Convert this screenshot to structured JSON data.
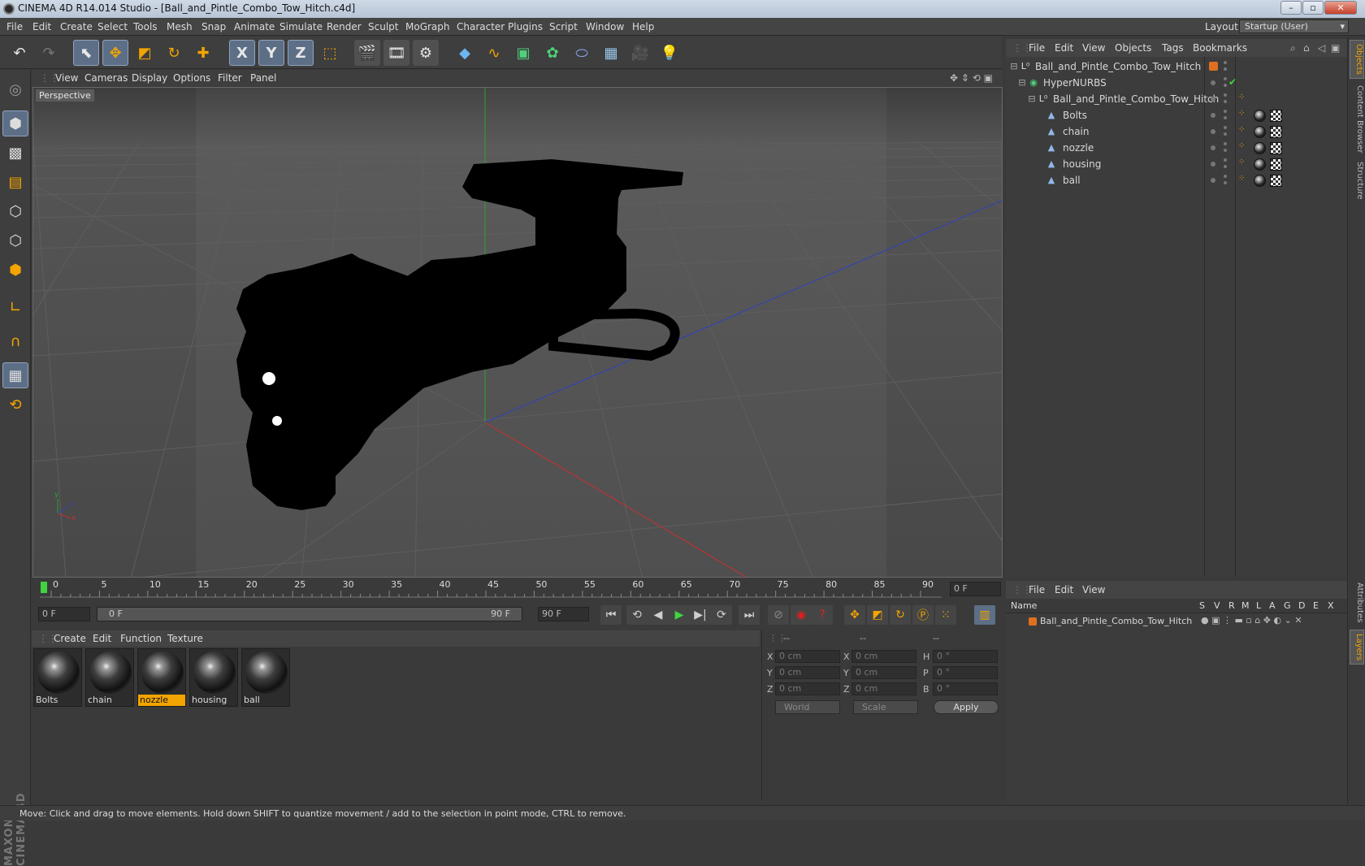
{
  "app": {
    "title": "CINEMA 4D R14.014 Studio - [Ball_and_Pintle_Combo_Tow_Hitch.c4d]",
    "window_buttons": {
      "minimize": "–",
      "maximize": "▫",
      "close": "✕"
    }
  },
  "menubar": {
    "items": [
      "File",
      "Edit",
      "Create",
      "Select",
      "Tools",
      "Mesh",
      "Snap",
      "Animate",
      "Simulate",
      "Render",
      "Sculpt",
      "MoGraph",
      "Character",
      "Plugins",
      "Script",
      "Window",
      "Help"
    ],
    "layout_label": "Layout:",
    "layout_value": "Startup (User)"
  },
  "toolbar": {
    "icons": [
      "undo-icon",
      "redo-icon",
      "live-selection-icon",
      "move-icon",
      "scale-icon",
      "rotate-icon",
      "last-tool-icon",
      "x-axis-icon",
      "y-axis-icon",
      "z-axis-icon",
      "coordinate-system-icon",
      "render-view-icon",
      "render-picture-viewer-icon",
      "render-settings-icon",
      "cube-icon",
      "spline-icon",
      "nurbs-icon",
      "array-icon",
      "deformer-icon",
      "floor-icon",
      "camera-icon",
      "light-icon"
    ],
    "axis_labels": {
      "x": "X",
      "y": "Y",
      "z": "Z"
    }
  },
  "viewport": {
    "menu": [
      "View",
      "Cameras",
      "Display",
      "Options",
      "Filter",
      "Panel"
    ],
    "label": "Perspective",
    "axes": {
      "x": "x",
      "y": "y",
      "z": "z"
    }
  },
  "timeline": {
    "ticks": [
      "0",
      "5",
      "10",
      "15",
      "20",
      "25",
      "30",
      "35",
      "40",
      "45",
      "50",
      "55",
      "60",
      "65",
      "70",
      "75",
      "80",
      "85",
      "90"
    ],
    "current_frame_right": "0 F",
    "start_field": "0 F",
    "range_start": "0 F",
    "range_end": "90 F",
    "end_field": "90 F"
  },
  "material_manager": {
    "menu": [
      "Create",
      "Edit",
      "Function",
      "Texture"
    ],
    "materials": [
      {
        "name": "Bolts",
        "selected": false
      },
      {
        "name": "chain",
        "selected": false
      },
      {
        "name": "nozzle",
        "selected": true
      },
      {
        "name": "housing",
        "selected": false
      },
      {
        "name": "ball",
        "selected": false
      }
    ]
  },
  "coordinates": {
    "headers": [
      "--",
      "--",
      "--"
    ],
    "rows": [
      {
        "a_label": "X",
        "a_value": "0 cm",
        "b_label": "X",
        "b_value": "0 cm",
        "c_label": "H",
        "c_value": "0 °"
      },
      {
        "a_label": "Y",
        "a_value": "0 cm",
        "b_label": "Y",
        "b_value": "0 cm",
        "c_label": "P",
        "c_value": "0 °"
      },
      {
        "a_label": "Z",
        "a_value": "0 cm",
        "b_label": "Z",
        "b_value": "0 cm",
        "c_label": "B",
        "c_value": "0 °"
      }
    ],
    "mode_select": "World",
    "scale_select": "Scale",
    "apply_label": "Apply"
  },
  "object_manager": {
    "menu": [
      "File",
      "Edit",
      "View",
      "Objects",
      "Tags",
      "Bookmarks"
    ],
    "objects": [
      {
        "name": "Ball_and_Pintle_Combo_Tow_Hitch",
        "type": "null"
      },
      {
        "name": "HyperNURBS",
        "type": "hypernurbs"
      },
      {
        "name": "Ball_and_Pintle_Combo_Tow_Hitch",
        "type": "null"
      },
      {
        "name": "Bolts",
        "type": "polygon"
      },
      {
        "name": "chain",
        "type": "polygon"
      },
      {
        "name": "nozzle",
        "type": "polygon"
      },
      {
        "name": "housing",
        "type": "polygon"
      },
      {
        "name": "ball",
        "type": "polygon"
      }
    ]
  },
  "layer_manager": {
    "menu": [
      "File",
      "Edit",
      "View"
    ],
    "columns": [
      "Name",
      "S",
      "V",
      "R",
      "M",
      "L",
      "A",
      "G",
      "D",
      "E",
      "X"
    ],
    "layers": [
      {
        "name": "Ball_and_Pintle_Combo_Tow_Hitch",
        "color": "#e07020"
      }
    ]
  },
  "side_tabs": [
    "Objects",
    "Content Browser",
    "Structure",
    "Attributes",
    "Layers"
  ],
  "branding": "MAXON CINEMA 4D",
  "status": "Move: Click and drag to move elements. Hold down SHIFT to quantize movement / add to the selection in point mode, CTRL to remove.",
  "colors": {
    "accent": "#f2a400",
    "selection": "#5d6f86",
    "x_axis": "#c83030",
    "y_axis": "#2fa02f",
    "z_axis": "#3040c0"
  }
}
